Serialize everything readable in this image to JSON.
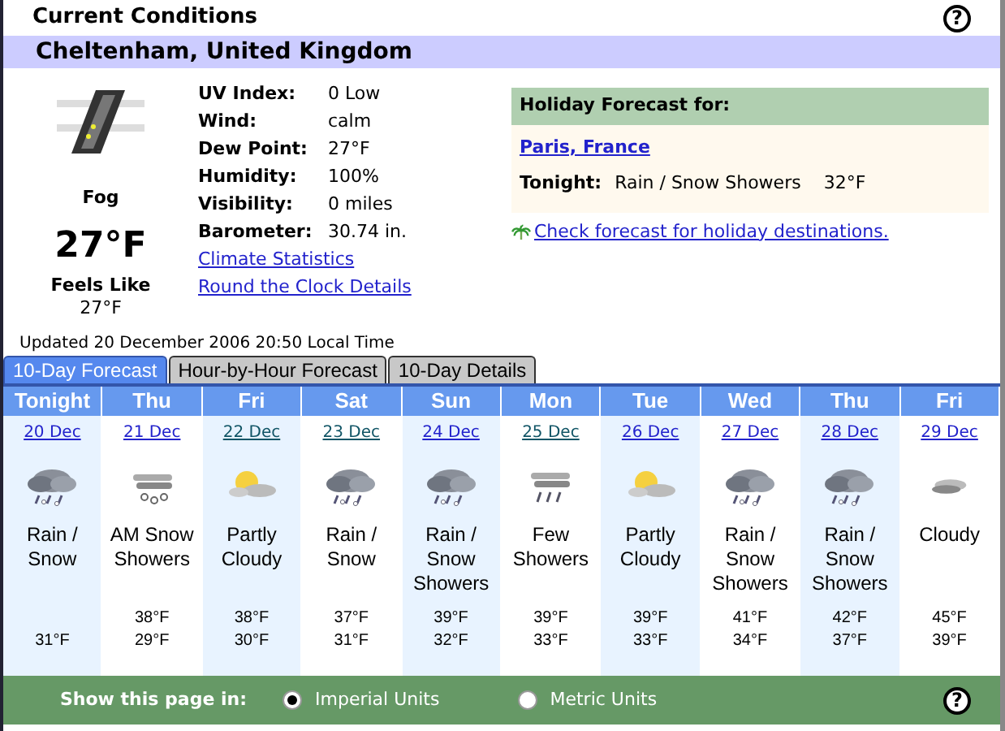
{
  "title": "Current Conditions",
  "help": "?",
  "location": "Cheltenham, United Kingdom",
  "current": {
    "kind": "fog",
    "condition": "Fog",
    "temperature": "27°F",
    "feels_like_label": "Feels Like",
    "feels_like": "27°F"
  },
  "details": [
    {
      "label": "UV Index:",
      "value": "0 Low"
    },
    {
      "label": "Wind:",
      "value": "calm"
    },
    {
      "label": "Dew Point:",
      "value": "27°F"
    },
    {
      "label": "Humidity:",
      "value": "100%"
    },
    {
      "label": "Visibility:",
      "value": "0 miles"
    },
    {
      "label": "Barometer:",
      "value": "30.74 in."
    }
  ],
  "links": [
    "Climate Statistics",
    "Round the Clock Details"
  ],
  "holiday": {
    "heading": "Holiday Forecast for:",
    "place": "Paris, France",
    "period": "Tonight:",
    "condition": "Rain / Snow Showers",
    "temperature": "32°F",
    "check_link": "Check forecast for holiday destinations."
  },
  "updated": "Updated 20 December 2006 20:50 Local Time",
  "tabs": [
    {
      "label": "10-Day Forecast",
      "selected": true
    },
    {
      "label": "Hour-by-Hour Forecast",
      "selected": false
    },
    {
      "label": "10-Day Details",
      "selected": false
    }
  ],
  "days": [
    {
      "day": "Tonight",
      "date": "20 Dec",
      "visited": false,
      "kind": "rain_snow",
      "condition": "Rain / Snow",
      "low": "31°F"
    },
    {
      "day": "Thu",
      "date": "21 Dec",
      "visited": false,
      "kind": "snow_showers",
      "condition": "AM Snow Showers",
      "high": "38°F",
      "low": "29°F"
    },
    {
      "day": "Fri",
      "date": "22 Dec",
      "visited": true,
      "kind": "partly_cloudy",
      "condition": "Partly Cloudy",
      "high": "38°F",
      "low": "30°F"
    },
    {
      "day": "Sat",
      "date": "23 Dec",
      "visited": true,
      "kind": "rain_snow",
      "condition": "Rain / Snow",
      "high": "37°F",
      "low": "31°F"
    },
    {
      "day": "Sun",
      "date": "24 Dec",
      "visited": false,
      "kind": "rain_snow",
      "condition": "Rain / Snow Showers",
      "high": "39°F",
      "low": "32°F"
    },
    {
      "day": "Mon",
      "date": "25 Dec",
      "visited": true,
      "kind": "showers",
      "condition": "Few Showers",
      "high": "39°F",
      "low": "33°F"
    },
    {
      "day": "Tue",
      "date": "26 Dec",
      "visited": false,
      "kind": "partly_cloudy",
      "condition": "Partly Cloudy",
      "high": "39°F",
      "low": "33°F"
    },
    {
      "day": "Wed",
      "date": "27 Dec",
      "visited": false,
      "kind": "rain_snow",
      "condition": "Rain / Snow Showers",
      "high": "41°F",
      "low": "34°F"
    },
    {
      "day": "Thu",
      "date": "28 Dec",
      "visited": false,
      "kind": "rain_snow",
      "condition": "Rain / Snow Showers",
      "high": "42°F",
      "low": "37°F"
    },
    {
      "day": "Fri",
      "date": "29 Dec",
      "visited": false,
      "kind": "cloudy",
      "condition": "Cloudy",
      "high": "45°F",
      "low": "39°F"
    }
  ],
  "units": {
    "help": "?",
    "label": "Show this page in:",
    "options": [
      {
        "label": "Imperial Units",
        "selected": true
      },
      {
        "label": "Metric Units",
        "selected": false
      }
    ]
  }
}
